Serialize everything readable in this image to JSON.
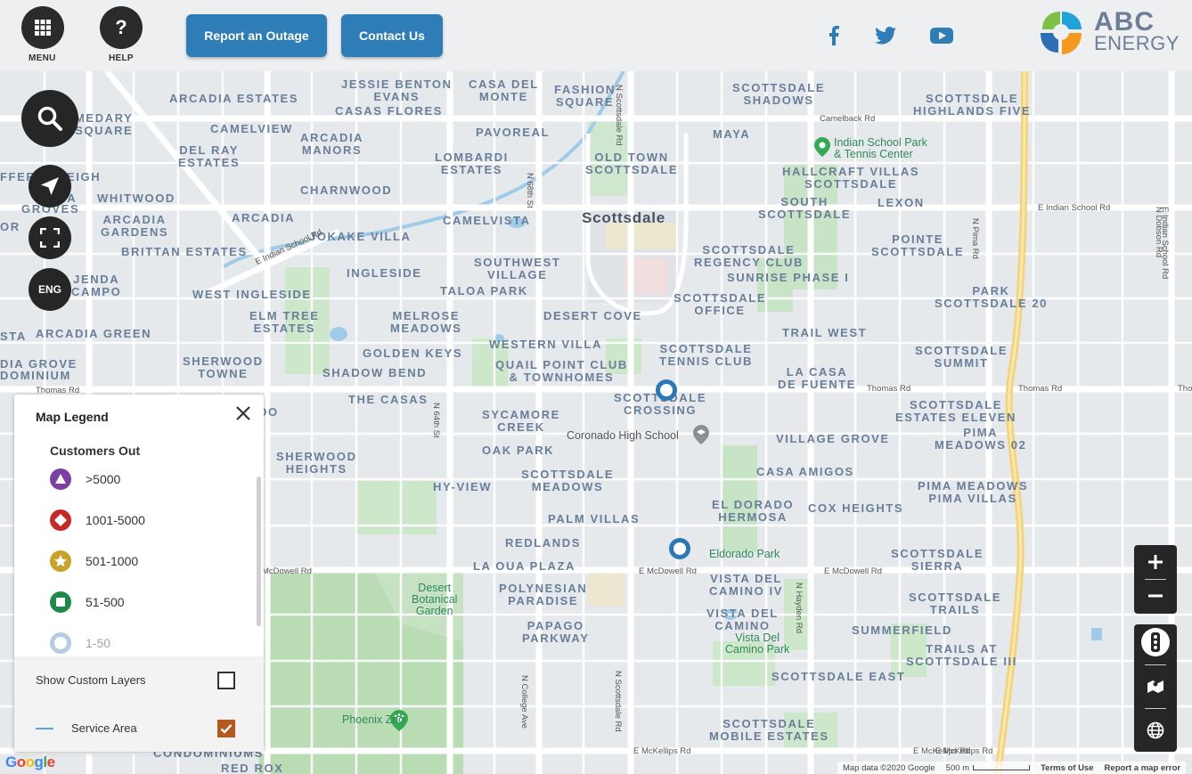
{
  "header": {
    "menu_label": "MENU",
    "help_label": "HELP",
    "report_outage": "Report an Outage",
    "contact_us": "Contact Us",
    "logo_line1": "ABC",
    "logo_line2": "ENERGY",
    "social_icons": [
      "facebook-icon",
      "twitter-icon",
      "youtube-icon"
    ],
    "brand_color": "#2f7db6"
  },
  "controls": {
    "language": "ENG"
  },
  "map": {
    "city": "Scottsdale",
    "neighborhoods": [
      "ARCADIA ESTATES",
      "JESSIE BENTON\nEVANS",
      "CASA DEL\nMONTE",
      "FASHION\nSQUARE",
      "SCOTTSDALE\nSHADOWS",
      "SCOTTSDALE\nHIGHLANDS FIVE",
      "MEDARY\nSQUARE",
      "CASAS FLORES",
      "CAMELVIEW",
      "ARCADIA\nMANORS",
      "PAVOREAL",
      "MAYA",
      "DEL RAY\nESTATES",
      "LOMBARDI\nESTATES",
      "OLD TOWN\nSCOTTSDALE",
      "HALLCRAFT VILLAS\nSCOTTSDALE",
      "WHITWOOD",
      "CHARNWOOD",
      "SOUTH\nSCOTTSDALE",
      "LEXON",
      "ARCADIA\nGARDENS",
      "ARCADIA",
      "CAMELVISTA",
      "JOKAKE VILLA",
      "POINTE\nSCOTTSDALE",
      "BRITTAN ESTATES",
      "SCOTTSDALE\nREGENCY CLUB",
      "SOUTHWEST\nVILLAGE",
      "INGLESIDE",
      "SUNRISE PHASE I",
      "WEST INGLESIDE",
      "TALOA PARK",
      "PARK\nSCOTTSDALE 20",
      "SCOTTSDALE\nOFFICE",
      "ELM TREE\nESTATES",
      "MELROSE\nMEADOWS",
      "DESERT COVE",
      "TRAIL WEST",
      "ARCADIA GREEN",
      "WESTERN VILLA",
      "SCOTTSDALE\nTENNIS CLUB",
      "SCOTTSDALE\nSUMMIT",
      "GOLDEN KEYS",
      "SHERWOOD\nTOWNE",
      "QUAIL POINT CLUB\n& TOWNHOMES",
      "SHADOW BEND",
      "LA CASA\nDE FUENTE",
      "THE CASAS",
      "SCOTTSDALE\nCROSSING",
      "SCOTTSDALE\nESTATES ELEVEN",
      "SYCAMORE\nCREEK",
      "PIMA\nMEADOWS 02",
      "VILLAGE GROVE",
      "OAK PARK",
      "SHERWOOD\nHEIGHTS",
      "SCOTTSDALE\nMEADOWS",
      "CASA AMIGOS",
      "HY-VIEW",
      "PIMA MEADOWS\nPIMA VILLAS",
      "EL DORADO\nHERMOSA",
      "COX HEIGHTS",
      "PALM VILLAS",
      "REDLANDS",
      "SCOTTSDALE\nSIERRA",
      "LA OUA PLAZA",
      "VISTA DEL\nCAMINO IV",
      "POLYNESIAN\nPARADISE",
      "SCOTTSDALE\nTRAILS",
      "VISTA DEL\nCAMINO",
      "PAPAGO\nPARKWAY",
      "SUMMERFIELD",
      "TRAILS AT\nSCOTTSDALE III",
      "SCOTTSDALE EAST",
      "SCOTTSDALE\nMOBILE ESTATES",
      "CONDOMINIUMS",
      "RED ROX",
      "DIA GROVE",
      "DOMINIUM",
      "STA",
      "JENDA\nCAMPO",
      "FFER",
      "EIGH",
      "IA",
      "GROVES",
      "OR",
      "DO"
    ],
    "roads": [
      "Camelback Rd",
      "N Scottsdale Rd",
      "N 68th St",
      "E Indian School Rd",
      "E Indian School Rd",
      "N Pima Rd",
      "N Dobson Rd",
      "Thomas Rd",
      "Thomas Rd",
      "Thomas Rd",
      "Tho",
      "N 64th St",
      "E McDowell Rd",
      "E McDowell Rd",
      "E McDowell Rd",
      "N Hayden Rd",
      "N College Ave",
      "N Scottsdale Rd",
      "E McKellips Rd",
      "E McKellips Rd",
      "E McKellips Rd",
      "E Indian School Rd"
    ],
    "pois": {
      "indian_school_park": "Indian School Park\n& Tennis Center",
      "coronado": "Coronado High School",
      "eldorado": "Eldorado Park",
      "botanical": "Desert\nBotanical\nGarden",
      "vista_del_camino": "Vista Del\nCamino Park",
      "phoenix_zoo": "Phoenix Zoo"
    },
    "outage_markers": 2,
    "attribution": {
      "map_data": "Map data ©2020 Google",
      "scale": "500 m",
      "terms": "Terms of Use",
      "report": "Report a map error",
      "google": "Google"
    }
  },
  "legend": {
    "title": "Map Legend",
    "subtitle": "Customers Out",
    "items": [
      {
        "label": ">5000",
        "color": "#7b3fa6"
      },
      {
        "label": "1001-5000",
        "color": "#c62828"
      },
      {
        "label": "501-1000",
        "color": "#c9a227"
      },
      {
        "label": "51-500",
        "color": "#1e8a4a"
      },
      {
        "label": "1-50",
        "color": "#5a8fc5"
      }
    ],
    "show_custom_layers": "Show Custom Layers",
    "service_area": "Service Area",
    "service_area_checked": true,
    "custom_layers_checked": false
  }
}
